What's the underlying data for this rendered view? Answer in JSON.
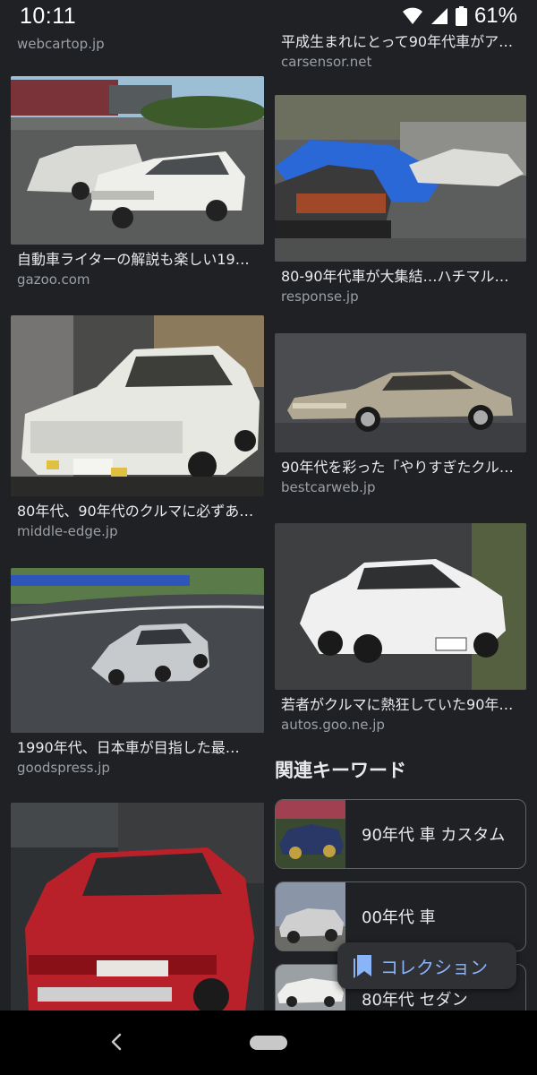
{
  "status_bar": {
    "time": "10:11",
    "battery_percent": "61%"
  },
  "left_column": [
    {
      "title": "",
      "domain": "webcartop.jp"
    },
    {
      "title": "自動車ライターの解説も楽しい19…",
      "domain": "gazoo.com"
    },
    {
      "title": "80年代、90年代のクルマに必ずあ…",
      "domain": "middle-edge.jp"
    },
    {
      "title": "1990年代、日本車が目指した最…",
      "domain": "goodspress.jp"
    }
  ],
  "right_column": [
    {
      "title": "平成生まれにとって90年代車がア…",
      "domain": "carsensor.net"
    },
    {
      "title": "80-90年代車が大集結…ハチマル…",
      "domain": "response.jp"
    },
    {
      "title": "90年代を彩った「やりすぎたクル…",
      "domain": "bestcarweb.jp"
    },
    {
      "title": "若者がクルマに熱狂していた90年…",
      "domain": "autos.goo.ne.jp"
    }
  ],
  "related": {
    "heading": "関連キーワード",
    "keywords": [
      {
        "label": "90年代 車 カスタム"
      },
      {
        "label": "00年代 車"
      },
      {
        "label": "80年代 セダン"
      }
    ]
  },
  "collection_button": {
    "label": "コレクション"
  },
  "colors": {
    "background": "#202124",
    "link_blue": "#8ab4f8",
    "secondary_text": "#9aa0a6"
  }
}
